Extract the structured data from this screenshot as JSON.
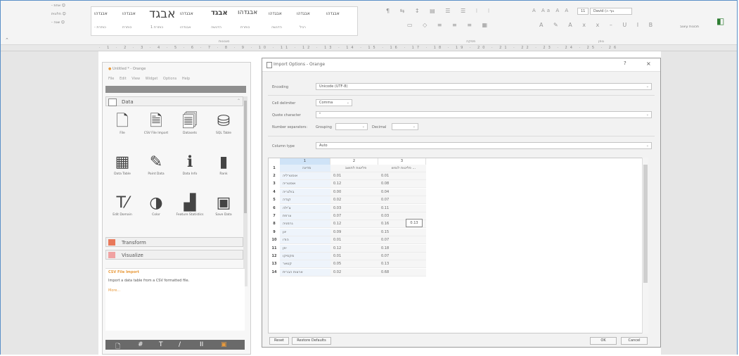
{
  "ribbon": {
    "left_items": [
      "- אחוז ☺",
      "חלונית ☺",
      "- שנה ☺"
    ],
    "styles": [
      "אבגדהו",
      "אבגדהו",
      "אבגד",
      "אבגדהו",
      "אבגד",
      "אבגדהו",
      "אבגדהו",
      "אבגדהו",
      "אבגדהו"
    ],
    "style_names": [
      "- כותרת",
      "כותרת",
      "כותרת 1",
      "אבגדהו",
      "הדגשה",
      "כותרת",
      "הדגשה",
      "רגיל"
    ],
    "group_styles": "סגנונות",
    "group_paragraph": "פסקה",
    "group_font": "גופן",
    "font_name": "David (גוף ה",
    "font_size": "11",
    "right_label": "תכונות עיצוב"
  },
  "orange": {
    "title": "Untitled * - Orange",
    "menu": [
      "File",
      "Edit",
      "View",
      "Widget",
      "Options",
      "Help"
    ],
    "categories": {
      "data": "Data",
      "transform": "Transform",
      "visualize": "Visualize"
    },
    "widgets": [
      {
        "icon": "file-icon",
        "glyph": "🗋",
        "label": "File"
      },
      {
        "icon": "csv-import-icon",
        "glyph": "🗎",
        "label": "CSV File Import"
      },
      {
        "icon": "datasets-icon",
        "glyph": "🗐",
        "label": "Datasets"
      },
      {
        "icon": "sql-table-icon",
        "glyph": "⛁",
        "label": "SQL Table"
      },
      {
        "icon": "data-table-icon",
        "glyph": "▦",
        "label": "Data Table"
      },
      {
        "icon": "paint-data-icon",
        "glyph": "✎",
        "label": "Paint Data"
      },
      {
        "icon": "data-info-icon",
        "glyph": "ℹ",
        "label": "Data Info"
      },
      {
        "icon": "rank-icon",
        "glyph": "▮",
        "label": "Rank"
      },
      {
        "icon": "edit-domain-icon",
        "glyph": "T⁄",
        "label": "Edit Domain"
      },
      {
        "icon": "color-icon",
        "glyph": "◑",
        "label": "Color"
      },
      {
        "icon": "feature-statistics-icon",
        "glyph": "▟",
        "label": "Feature Statistics"
      },
      {
        "icon": "save-data-icon",
        "glyph": "▣",
        "label": "Save Data"
      }
    ],
    "info": {
      "header": "CSV File Import",
      "text": "Import a data table from a CSV formatted file.",
      "more": "More..."
    },
    "toolbar": [
      "🗋",
      "#",
      "T",
      "/",
      "II",
      "▣"
    ]
  },
  "dialog": {
    "title": "Import Options - Orange",
    "help": "?",
    "close": "×",
    "encoding_label": "Encoding",
    "encoding_value": "Unicode (UTF-8)",
    "cell_delimiter_label": "Cell delimiter",
    "cell_delimiter_value": "Comma",
    "quote_label": "Quote character",
    "quote_value": "\"",
    "number_sep_label": "Number separators:",
    "grouping_label": "Grouping",
    "grouping_value": "",
    "decimal_label": "Decimal",
    "decimal_value": "",
    "column_type_label": "Column type",
    "column_type_value": "Auto",
    "table": {
      "col_numbers": [
        "1",
        "2",
        "3"
      ],
      "headers": [
        "מדינה",
        "פליטות לתושב",
        "פליטות לנפש ..."
      ],
      "rows": [
        [
          "אוסטרליה",
          "0.01",
          "0.01"
        ],
        [
          "אוסטריה",
          "0.12",
          "0.08"
        ],
        [
          "בולגריה",
          "0.00",
          "0.04"
        ],
        [
          "קנדה",
          "0.02",
          "0.07"
        ],
        [
          "צ'ילה",
          "0.03",
          "0.11"
        ],
        [
          "צרפת",
          "0.07",
          "0.03"
        ],
        [
          "גרמניה",
          "0.12",
          "0.16"
        ],
        [
          "יוון",
          "0.09",
          "0.15"
        ],
        [
          "הודו",
          "0.01",
          "0.07"
        ],
        [
          "יפן",
          "0.12",
          "0.18"
        ],
        [
          "מקסיקו",
          "0.01",
          "0.07"
        ],
        [
          "קטאר",
          "0.05",
          "0.13"
        ],
        [
          "ארצות הברית",
          "0.02",
          "0.68"
        ]
      ],
      "tooltip": "0.13"
    },
    "reset": "Reset",
    "restore_defaults": "Restore Defaults",
    "ok": "OK",
    "cancel": "Cancel"
  }
}
